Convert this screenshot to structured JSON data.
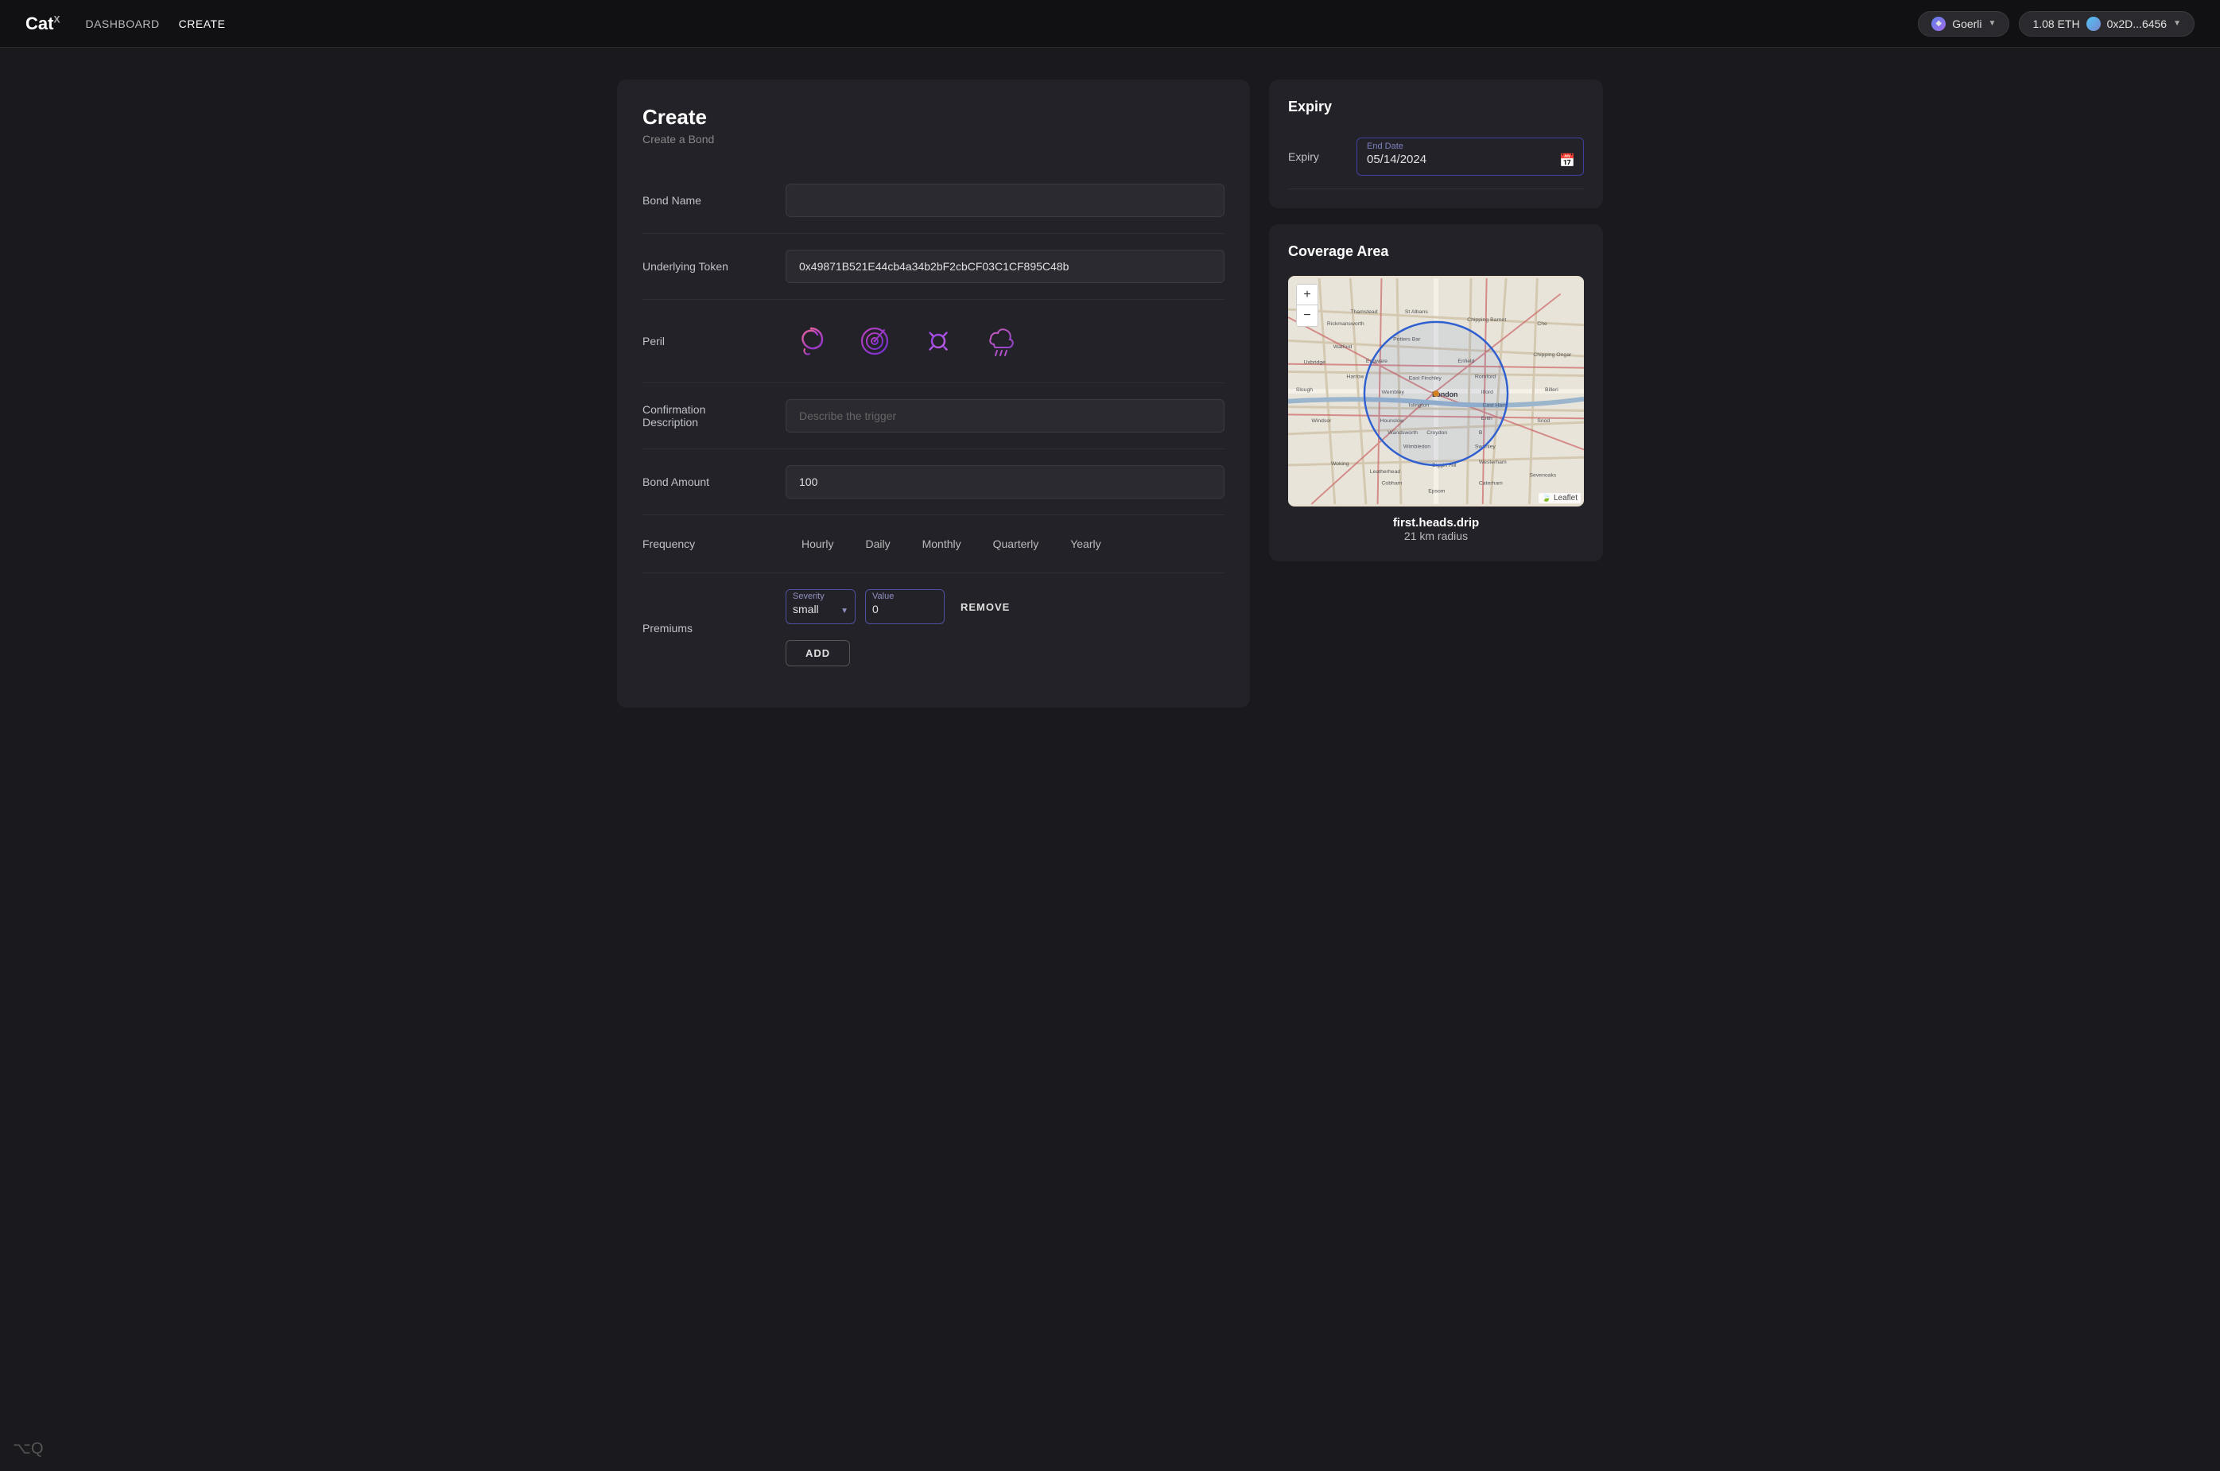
{
  "app": {
    "logo": "Cat",
    "logo_sup": "X"
  },
  "navbar": {
    "links": [
      {
        "label": "DASHBOARD",
        "active": false
      },
      {
        "label": "CREATE",
        "active": true
      }
    ],
    "network_label": "Goerli",
    "eth_amount": "1.08 ETH",
    "wallet_address": "0x2D...6456"
  },
  "left_panel": {
    "title": "Create",
    "subtitle": "Create a Bond",
    "bond_name_label": "Bond Name",
    "bond_name_placeholder": "",
    "underlying_token_label": "Underlying Token",
    "underlying_token_value": "0x49871B521E44cb4a34b2bF2cbCF03C1CF895C48b",
    "peril_label": "Peril",
    "peril_icons": [
      {
        "name": "cyclone-icon",
        "type": "cyclone"
      },
      {
        "name": "radar-icon",
        "type": "radar"
      },
      {
        "name": "heat-icon",
        "type": "heat"
      },
      {
        "name": "rain-icon",
        "type": "rain"
      }
    ],
    "confirmation_label": "Confirmation\nDescription",
    "confirmation_placeholder": "Describe the trigger",
    "bond_amount_label": "Bond Amount",
    "bond_amount_value": "100",
    "frequency_label": "Frequency",
    "frequency_options": [
      "Hourly",
      "Daily",
      "Monthly",
      "Quarterly",
      "Yearly"
    ],
    "premiums_label": "Premiums",
    "severity_label": "Severity",
    "severity_value": "small",
    "value_label": "Value",
    "value_value": "0",
    "remove_label": "REMOVE",
    "add_label": "ADD"
  },
  "right_panel": {
    "expiry_title": "Expiry",
    "expiry_label": "Expiry",
    "end_date_label": "End Date",
    "end_date_value": "05/14/2024",
    "coverage_title": "Coverage Area",
    "coverage_name": "first.heads.drip",
    "coverage_radius": "21 km radius",
    "leaflet_credit": "Leaflet",
    "zoom_plus": "+",
    "zoom_minus": "−"
  }
}
